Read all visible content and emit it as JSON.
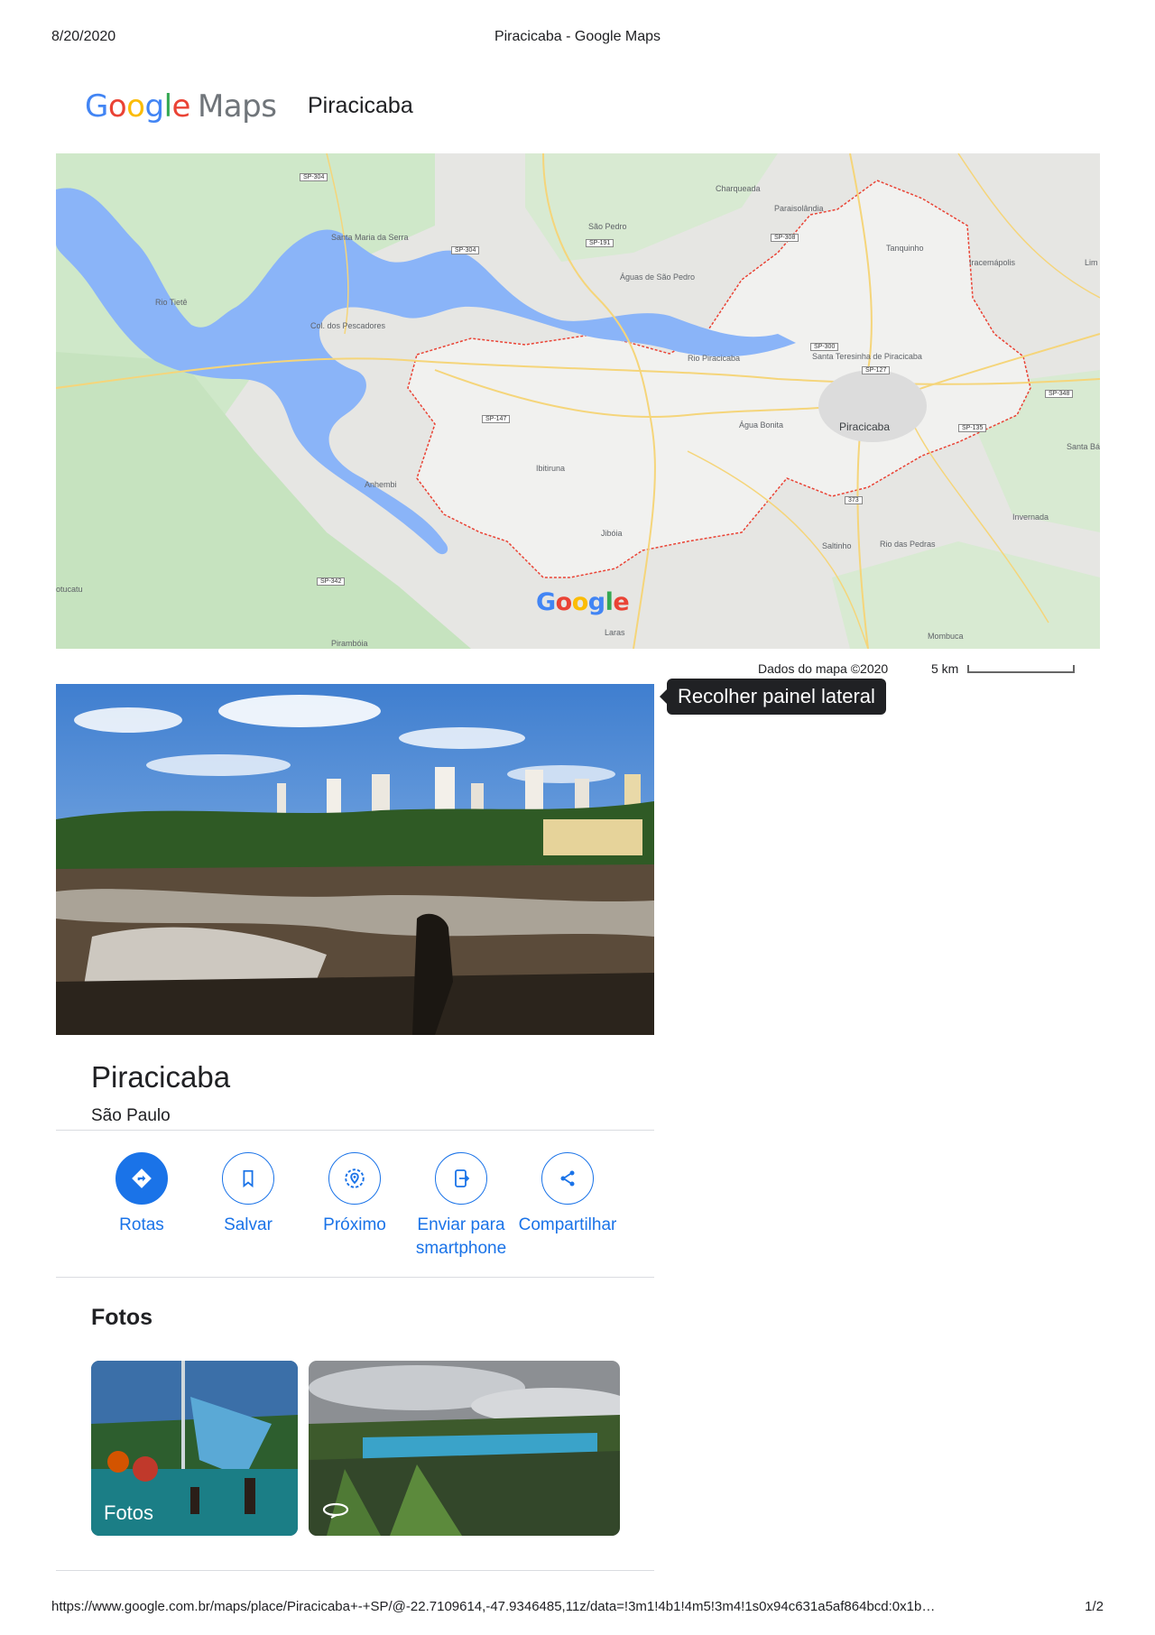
{
  "print_header": {
    "date": "8/20/2020",
    "title": "Piracicaba - Google Maps"
  },
  "brand": {
    "logo_text": "Google",
    "product": "Maps",
    "place": "Piracicaba"
  },
  "map": {
    "attribution": "Dados do mapa ©2020",
    "scale_label": "5 km",
    "logo_text": "Google",
    "labels": {
      "charqueada": "Charqueada",
      "paraisolandia": "Paraisolândia",
      "sao_pedro": "São Pedro",
      "santa_maria": "Santa Maria da Serra",
      "aguas_sao_pedro": "Águas de São Pedro",
      "tanquinho": "Tanquinho",
      "iracemapolis": "Iracemápolis",
      "limeira": "Lim",
      "colonia": "Col. dos Pescadores",
      "santa_teresinha": "Santa Teresinha de Piracicaba",
      "piracicaba": "Piracicaba",
      "agua_bonita": "Água Bonita",
      "santa_barbara": "Santa Bárbara D'Oeste",
      "ibitiruna": "Ibitiruna",
      "anhembi": "Anhembi",
      "jibóia": "Jibóia",
      "saltinho": "Saltinho",
      "rio_pedras": "Rio das Pedras",
      "invernada": "Invernada",
      "botucatu": "otucatu",
      "piramboia": "Pirambóia",
      "laras": "Laras",
      "mombuca": "Mombuca",
      "rio_tiete": "Rio Tietê",
      "rio_piracicaba": "Rio Piracicaba"
    },
    "shields": {
      "sp304_a": "SP-304",
      "sp304_b": "SP-304",
      "sp191": "SP-191",
      "sp308": "SP-308",
      "sp300": "SP-300",
      "sp127": "SP-127",
      "sp147": "SP-147",
      "sp135": "SP-135",
      "sp348": "SP-348",
      "r373": "373",
      "sp342": "SP-342"
    }
  },
  "tooltip": {
    "text": "Recolher painel lateral"
  },
  "place": {
    "name": "Piracicaba",
    "region": "São Paulo"
  },
  "actions": [
    {
      "label": "Rotas",
      "icon": "directions-icon"
    },
    {
      "label": "Salvar",
      "icon": "bookmark-icon"
    },
    {
      "label": "Próximo",
      "icon": "nearby-icon"
    },
    {
      "label": "Enviar para smartphone",
      "icon": "send-to-phone-icon"
    },
    {
      "label": "Compartilhar",
      "icon": "share-icon"
    }
  ],
  "photos": {
    "title": "Fotos",
    "tile_label": "Fotos",
    "panorama_icon": "360-icon"
  },
  "print_footer": {
    "url": "https://www.google.com.br/maps/place/Piracicaba+-+SP/@-22.7109614,-47.9346485,11z/data=!3m1!4b1!4m5!3m4!1s0x94c631a5af864bcd:0x1b…",
    "page": "1/2"
  },
  "colors": {
    "accent": "#1a73e8",
    "boundary": "#ea4335",
    "water": "#8ab4f8"
  }
}
